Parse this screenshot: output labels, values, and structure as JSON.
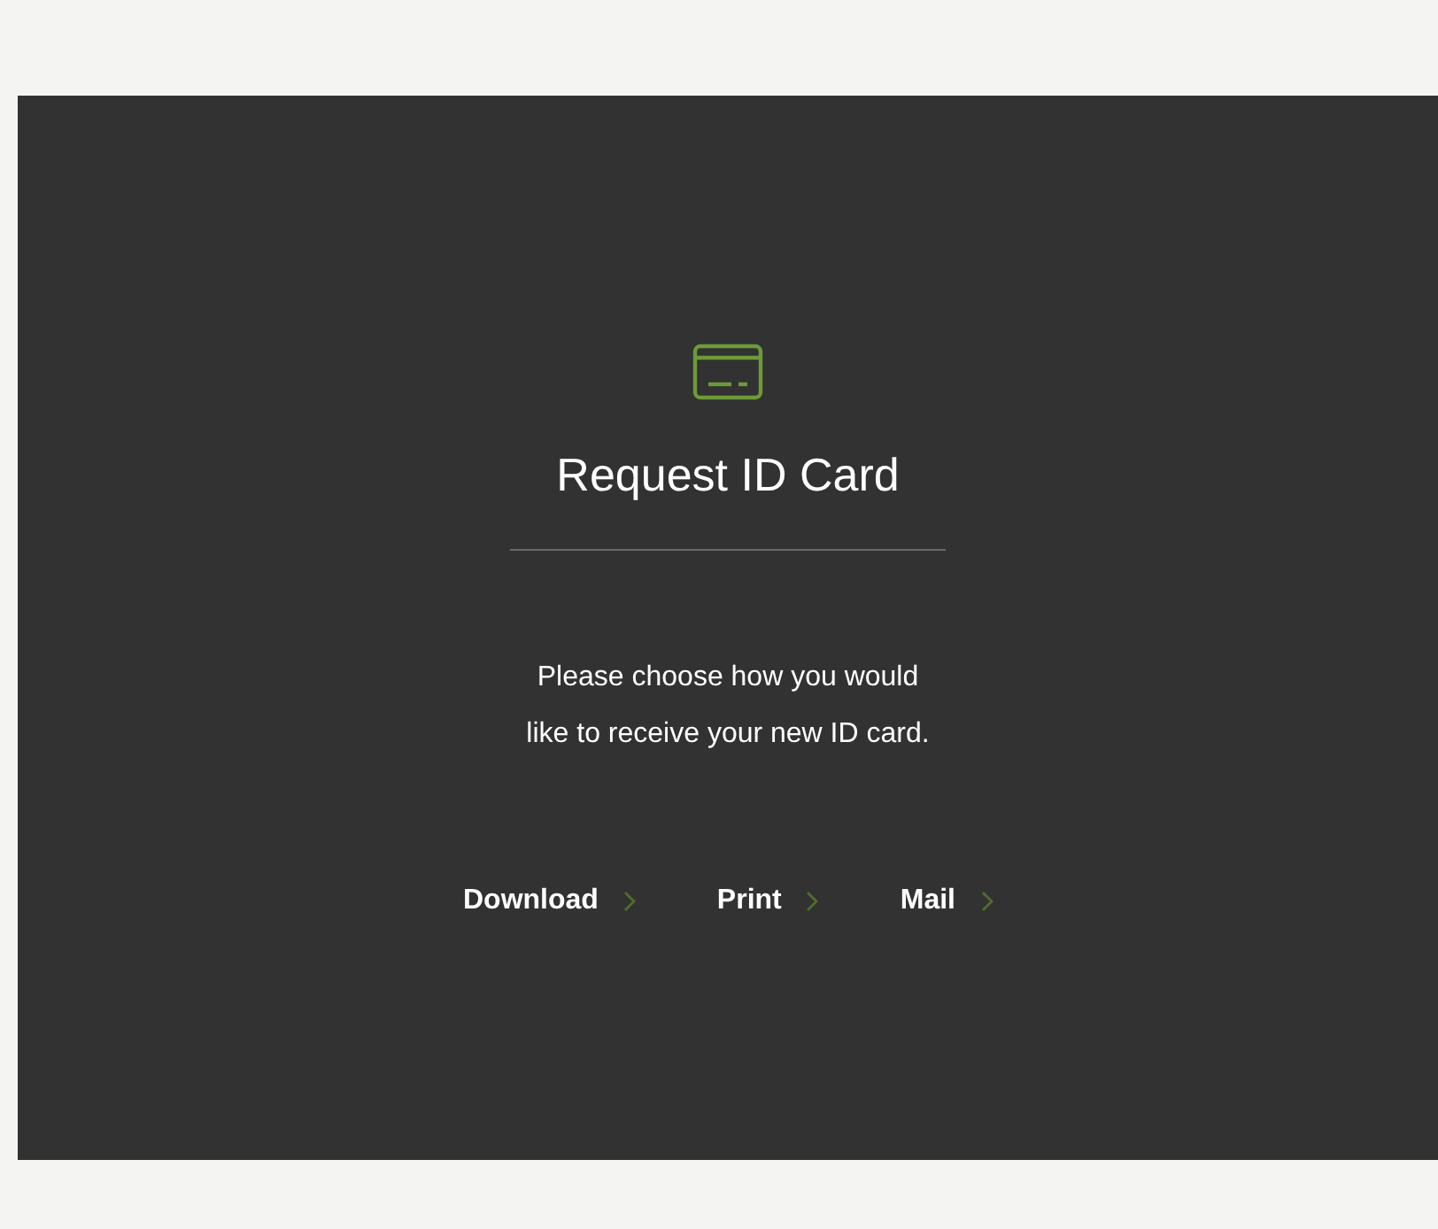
{
  "panel": {
    "title": "Request ID Card",
    "description": [
      "Please choose how you would",
      "like to receive your new ID card."
    ],
    "options": [
      {
        "label": "Download"
      },
      {
        "label": "Print"
      },
      {
        "label": "Mail"
      }
    ]
  }
}
